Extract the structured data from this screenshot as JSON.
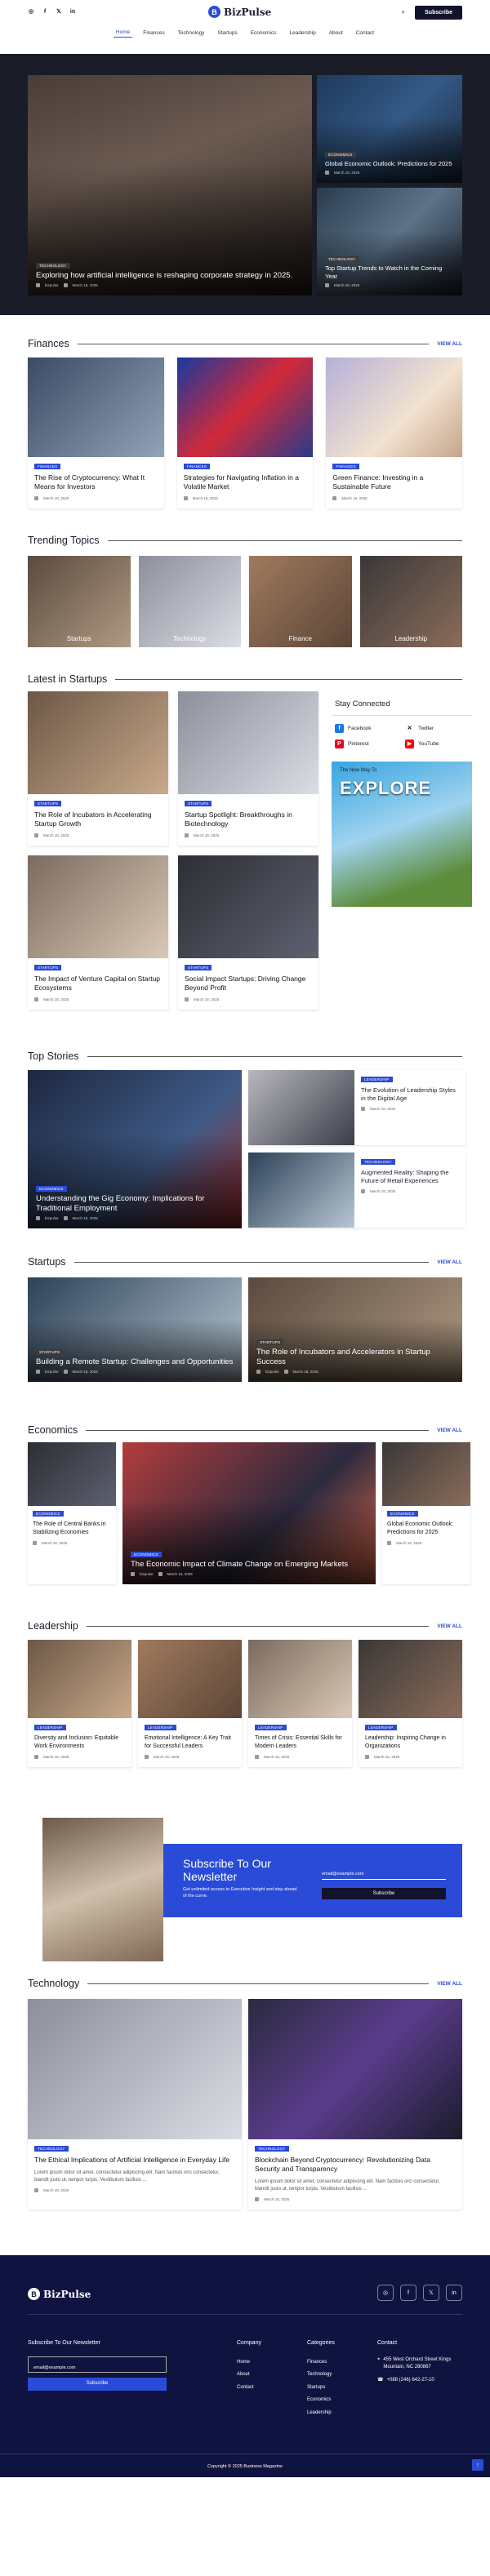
{
  "brand": "BizPulse",
  "header": {
    "subscribe": "Subscribe",
    "social": [
      "instagram-icon",
      "facebook-icon",
      "x-icon",
      "linkedin-icon"
    ]
  },
  "nav": [
    "Home",
    "Finances",
    "Technology",
    "Startups",
    "Economics",
    "Leadership",
    "About",
    "Contact"
  ],
  "hero": {
    "main": {
      "tag": "TECHNOLOGY",
      "title": "Exploring how artificial intelligence is reshaping corporate strategy in 2025.",
      "author": "bizpulse",
      "date": "March 18, 2025"
    },
    "side": [
      {
        "tag": "ECONOMICS",
        "title": "Global Economic Outlook: Predictions for 2025",
        "date": "March 18, 2025"
      },
      {
        "tag": "TECHNOLOGY",
        "title": "Top Startup Trends to Watch in the Coming Year",
        "date": "March 18, 2025"
      }
    ]
  },
  "view_all": "VIEW ALL",
  "finances": {
    "heading": "Finances",
    "cards": [
      {
        "tag": "FINANCES",
        "title": "The Rise of Cryptocurrency: What It Means for Investors",
        "date": "March 18, 2025"
      },
      {
        "tag": "FINANCES",
        "title": "Strategies for Navigating Inflation in a Volatile Market",
        "date": "March 18, 2025"
      },
      {
        "tag": "FINANCES",
        "title": "Green Finance: Investing in a Sustainable Future",
        "date": "March 18, 2025"
      }
    ]
  },
  "trending": {
    "heading": "Trending Topics",
    "items": [
      "Startups",
      "Technology",
      "Finance",
      "Leadership"
    ]
  },
  "latest": {
    "heading": "Latest in Startups",
    "cards": [
      {
        "tag": "STARTUPS",
        "title": "The Role of Incubators in Accelerating Startup Growth",
        "date": "March 18, 2025"
      },
      {
        "tag": "STARTUPS",
        "title": "Startup Spotlight: Breakthroughs in Biotechnology",
        "date": "March 18, 2025"
      },
      {
        "tag": "STARTUPS",
        "title": "The Impact of Venture Capital on Startup Ecosystems",
        "date": "March 18, 2025"
      },
      {
        "tag": "STARTUPS",
        "title": "Social Impact Startups: Driving Change Beyond Profit",
        "date": "March 18, 2025"
      }
    ]
  },
  "stay": {
    "heading": "Stay Connected",
    "items": [
      {
        "name": "Facebook",
        "icon": "facebook-icon",
        "color": "#1877f2"
      },
      {
        "name": "Twitter",
        "icon": "x-icon",
        "color": "#111111"
      },
      {
        "name": "Pinterest",
        "icon": "pinterest-icon",
        "color": "#e60023"
      },
      {
        "name": "YouTube",
        "icon": "youtube-icon",
        "color": "#ff0000"
      }
    ],
    "ad_small": "The New Way To",
    "ad_big": "EXPLORE"
  },
  "top": {
    "heading": "Top Stories",
    "main": {
      "tag": "ECONOMICS",
      "title": "Understanding the Gig Economy: Implications for Traditional Employment",
      "author": "bizpulse",
      "date": "March 18, 2025"
    },
    "side": [
      {
        "tag": "LEADERSHIP",
        "title": "The Evolution of Leadership Styles in the Digital Age",
        "date": "March 18, 2025"
      },
      {
        "tag": "TECHNOLOGY",
        "title": "Augmented Reality: Shaping the Future of Retail Experiences",
        "date": "March 18, 2025"
      }
    ]
  },
  "startups": {
    "heading": "Startups",
    "items": [
      {
        "tag": "STARTUPS",
        "title": "Building a Remote Startup: Challenges and Opportunities",
        "author": "bizpulse",
        "date": "March 18, 2025"
      },
      {
        "tag": "STARTUPS",
        "title": "The Role of Incubators and Accelerators in Startup Success",
        "author": "bizpulse",
        "date": "March 18, 2025"
      }
    ]
  },
  "economics": {
    "heading": "Economics",
    "left": {
      "tag": "ECONOMICS",
      "title": "The Role of Central Banks in Stabilizing Economies",
      "date": "March 18, 2025"
    },
    "mid": {
      "tag": "ECONOMICS",
      "title": "The Economic Impact of Climate Change on Emerging Markets",
      "author": "bizpulse",
      "date": "March 18, 2025"
    },
    "right": {
      "tag": "ECONOMICS",
      "title": "Global Economic Outlook: Predictions for 2025",
      "date": "March 18, 2025"
    }
  },
  "leadership": {
    "heading": "Leadership",
    "cards": [
      {
        "tag": "LEADERSHIP",
        "title": "Diversity and Inclusion: Equitable Work Environments",
        "date": "March 18, 2025"
      },
      {
        "tag": "LEADERSHIP",
        "title": "Emotional Intelligence: A Key Trait for Successful Leaders",
        "date": "March 18, 2025"
      },
      {
        "tag": "LEADERSHIP",
        "title": "Times of Crisis: Essential Skills for Modern Leaders",
        "date": "March 18, 2025"
      },
      {
        "tag": "LEADERSHIP",
        "title": "Leadership: Inspiring Change in Organizations",
        "date": "March 18, 2025"
      }
    ]
  },
  "newsletter": {
    "title": "Subscribe To Our Newsletter",
    "desc": "Get unlimited access to Executive Insight and stay ahead of the curve.",
    "placeholder": "email@example.com",
    "button": "Subscribe"
  },
  "technology": {
    "heading": "Technology",
    "cards": [
      {
        "tag": "TECHNOLOGY",
        "title": "The Ethical Implications of Artificial Intelligence in Everyday Life",
        "excerpt": "Lorem ipsum dolor sit amet, consectetur adipiscing elit. Nam facilisis orci consectetur, blandit justo ut, tempor turpis. Vestibulum facilisis ...",
        "date": "March 18, 2025"
      },
      {
        "tag": "TECHNOLOGY",
        "title": "Blockchain Beyond Cryptocurrency: Revolutionizing Data Security and Transparency",
        "excerpt": "Lorem ipsum dolor sit amet, consectetur adipiscing elit. Nam facilisis orci consectetur, blandit justo ut, tempor turpis. Vestibulum facilisis ...",
        "date": "March 18, 2025"
      }
    ]
  },
  "footer": {
    "nl_title": "Subscribe To Our Newsletter",
    "nl_placeholder": "email@example.com",
    "nl_button": "Subscribe",
    "company": {
      "heading": "Company",
      "links": [
        "Home",
        "About",
        "Contact"
      ]
    },
    "categories": {
      "heading": "Categories",
      "links": [
        "Finances",
        "Technology",
        "Startups",
        "Economics",
        "Leadership"
      ]
    },
    "contact": {
      "heading": "Contact",
      "address": "455 West Orchard Street Kings Mountain, NC 280867",
      "phone": "+088 (246) 642-27-10"
    },
    "copyright": "Copyright © 2025 Business Magazine"
  }
}
